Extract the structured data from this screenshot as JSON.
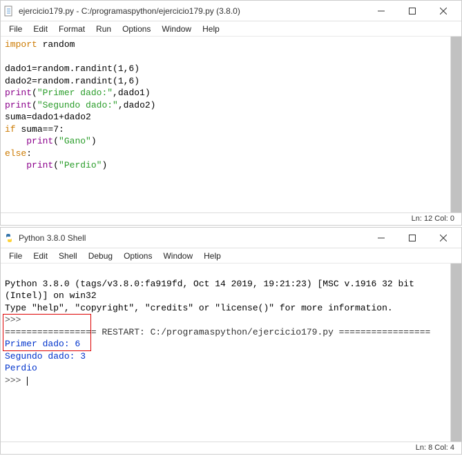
{
  "editor_window": {
    "title": "ejercicio179.py - C:/programaspython/ejercicio179.py (3.8.0)",
    "menu": [
      "File",
      "Edit",
      "Format",
      "Run",
      "Options",
      "Window",
      "Help"
    ],
    "code": {
      "tokens": [
        {
          "t": "import",
          "c": "kw-import"
        },
        {
          "t": " random\n",
          "c": ""
        },
        {
          "t": "\n",
          "c": ""
        },
        {
          "t": "dado1=random.randint(1,6)\n",
          "c": ""
        },
        {
          "t": "dado2=random.randint(1,6)\n",
          "c": ""
        },
        {
          "t": "print",
          "c": "func"
        },
        {
          "t": "(",
          "c": ""
        },
        {
          "t": "\"Primer dado:\"",
          "c": "str"
        },
        {
          "t": ",dado1)\n",
          "c": ""
        },
        {
          "t": "print",
          "c": "func"
        },
        {
          "t": "(",
          "c": ""
        },
        {
          "t": "\"Segundo dado:\"",
          "c": "str"
        },
        {
          "t": ",dado2)\n",
          "c": ""
        },
        {
          "t": "suma=dado1+dado2\n",
          "c": ""
        },
        {
          "t": "if",
          "c": "kw-if"
        },
        {
          "t": " suma==7:\n",
          "c": ""
        },
        {
          "t": "    ",
          "c": ""
        },
        {
          "t": "print",
          "c": "func"
        },
        {
          "t": "(",
          "c": ""
        },
        {
          "t": "\"Gano\"",
          "c": "str"
        },
        {
          "t": ")\n",
          "c": ""
        },
        {
          "t": "else",
          "c": "kw-else"
        },
        {
          "t": ":\n",
          "c": ""
        },
        {
          "t": "    ",
          "c": ""
        },
        {
          "t": "print",
          "c": "func"
        },
        {
          "t": "(",
          "c": ""
        },
        {
          "t": "\"Perdio\"",
          "c": "str"
        },
        {
          "t": ")\n",
          "c": ""
        }
      ]
    },
    "status": "Ln: 12  Col: 0"
  },
  "shell_window": {
    "title": "Python 3.8.0 Shell",
    "menu": [
      "File",
      "Edit",
      "Shell",
      "Debug",
      "Options",
      "Window",
      "Help"
    ],
    "banner1": "Python 3.8.0 (tags/v3.8.0:fa919fd, Oct 14 2019, 19:21:23) [MSC v.1916 32 bit (Intel)] on win32",
    "banner2": "Type \"help\", \"copyright\", \"credits\" or \"license()\" for more information.",
    "prompt": ">>>",
    "restart": "================= RESTART: C:/programaspython/ejercicio179.py =================",
    "out1": "Primer dado: 6",
    "out2": "Segundo dado: 3",
    "out3": "Perdio",
    "status": "Ln: 8  Col: 4"
  }
}
